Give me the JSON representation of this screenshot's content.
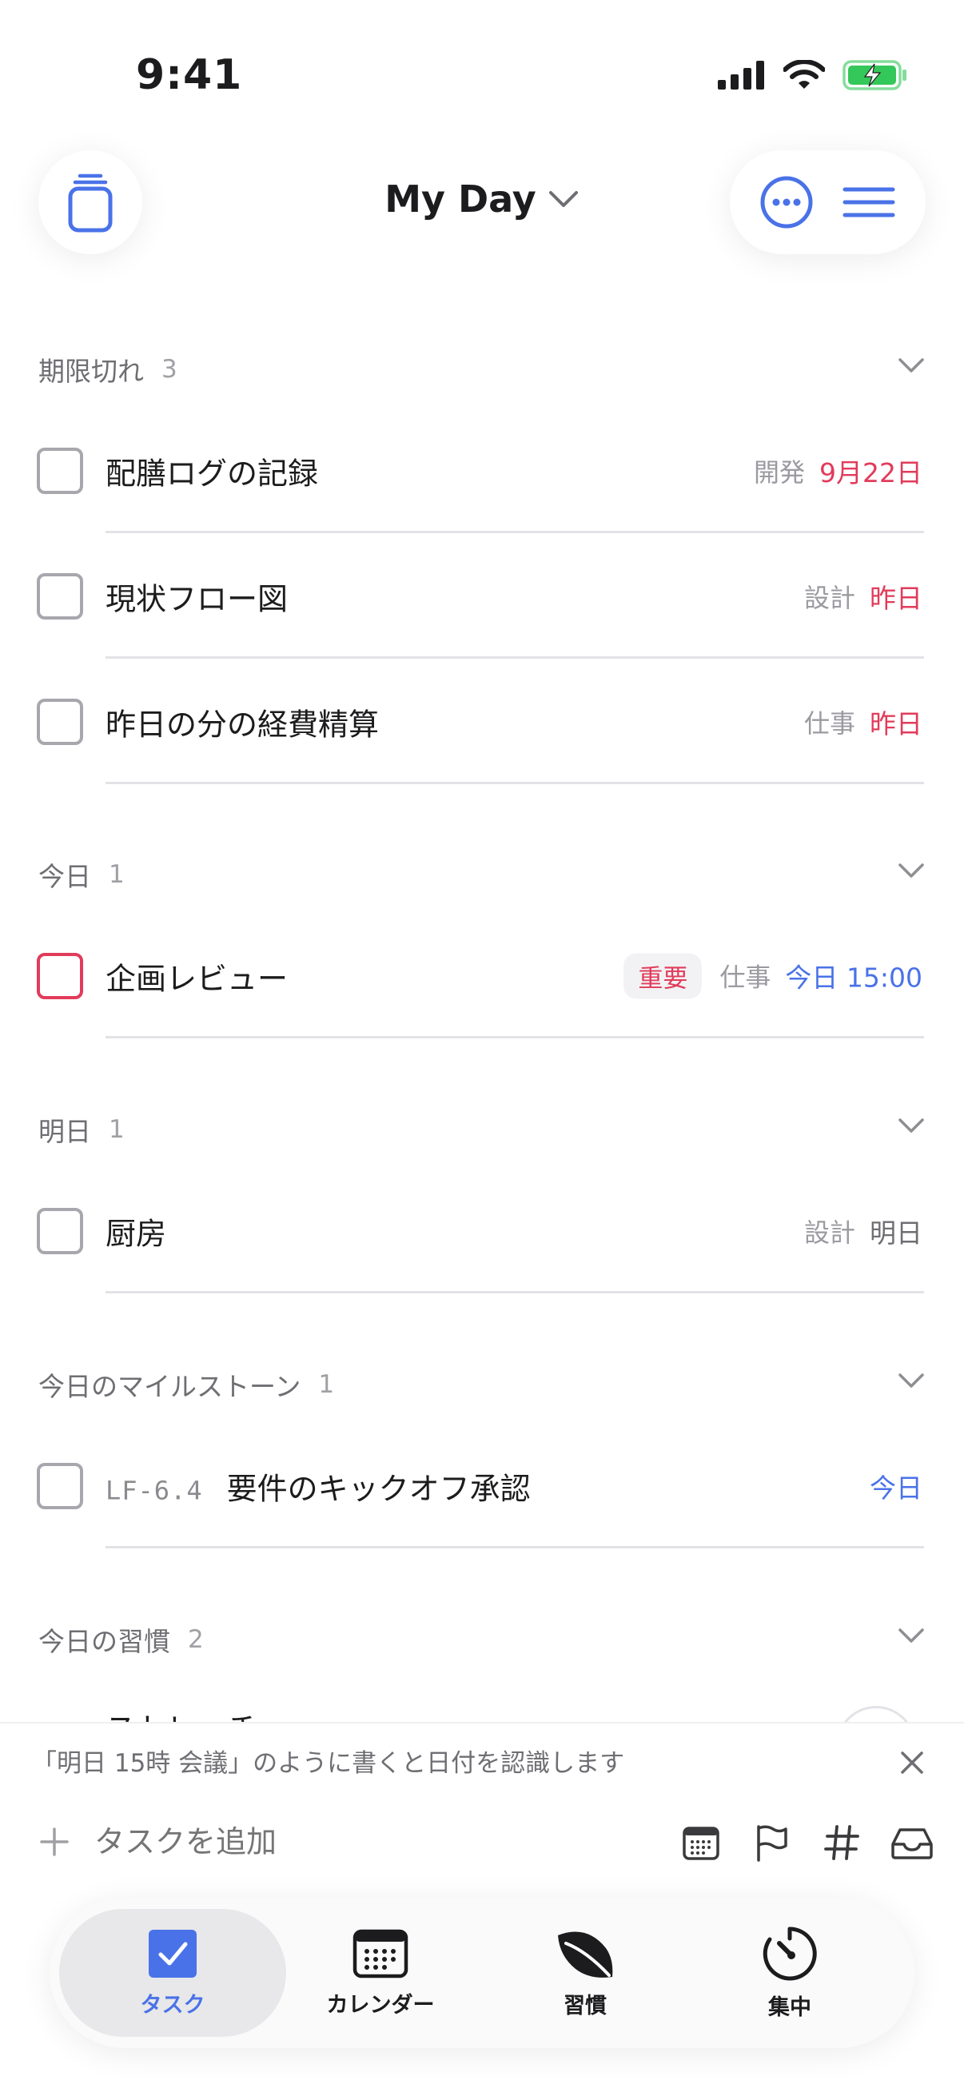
{
  "status_bar": {
    "time": "9:41"
  },
  "header": {
    "title": "My Day"
  },
  "sections": {
    "overdue": {
      "title": "期限切れ",
      "count": "3",
      "items": [
        {
          "title": "配膳ログの記録",
          "tag": "開発",
          "date": "9月22日"
        },
        {
          "title": "現状フロー図",
          "tag": "設計",
          "date": "昨日"
        },
        {
          "title": "昨日の分の経費精算",
          "tag": "仕事",
          "date": "昨日"
        }
      ]
    },
    "today": {
      "title": "今日",
      "count": "1",
      "items": [
        {
          "title": "企画レビュー",
          "badge": "重要",
          "tag": "仕事",
          "date": "今日 15:00"
        }
      ]
    },
    "tomorrow": {
      "title": "明日",
      "count": "1",
      "items": [
        {
          "title": "厨房",
          "tag": "設計",
          "date": "明日"
        }
      ]
    },
    "milestones": {
      "title": "今日のマイルストーン",
      "count": "1",
      "items": [
        {
          "code": "LF-6.4",
          "title": "要件のキックオフ承認",
          "date": "今日"
        }
      ]
    },
    "habits": {
      "title": "今日の習慣",
      "count": "2",
      "items": [
        {
          "title": "ストレッチ"
        }
      ]
    }
  },
  "hint": {
    "text": "「明日 15時 会議」のように書くと日付を認識します"
  },
  "add_task": {
    "placeholder": "タスクを追加"
  },
  "tabs": [
    {
      "label": "タスク",
      "active": true
    },
    {
      "label": "カレンダー"
    },
    {
      "label": "習慣"
    },
    {
      "label": "集中"
    }
  ],
  "colors": {
    "accent": "#4a72e8",
    "overdue_red": "#e23b5a",
    "tag_gray": "#9a9aa0",
    "battery_green": "#34c759"
  }
}
